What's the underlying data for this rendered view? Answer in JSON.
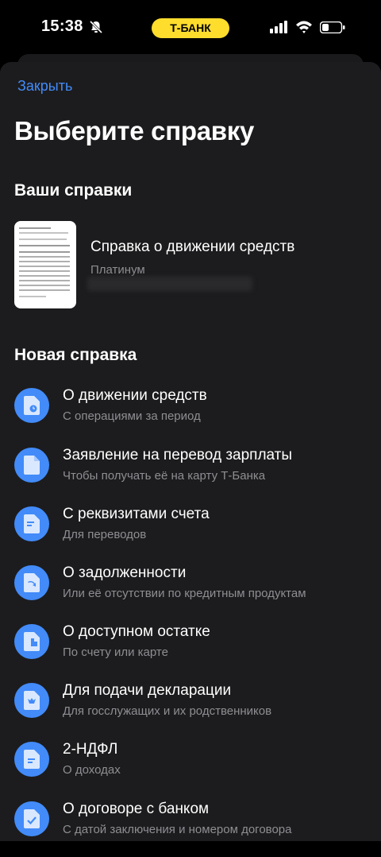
{
  "status_bar": {
    "time": "15:38",
    "bank_pill": "Т-БАНК"
  },
  "colors": {
    "accent": "#428bf9",
    "sheet": "#1c1c1e",
    "pill": "#ffdd2d"
  },
  "header": {
    "close_label": "Закрыть",
    "title": "Выберите справку"
  },
  "your_certificates": {
    "heading": "Ваши справки",
    "items": [
      {
        "title": "Справка о движении средств",
        "subtitle": "Платинум"
      }
    ]
  },
  "new_certificate": {
    "heading": "Новая справка",
    "items": [
      {
        "title": "О движении средств",
        "subtitle": "С операциями за период",
        "icon": "document-clock-icon"
      },
      {
        "title": "Заявление на перевод зарплаты",
        "subtitle": "Чтобы получать её на карту Т-Банка",
        "icon": "document-icon"
      },
      {
        "title": "С реквизитами счета",
        "subtitle": "Для переводов",
        "icon": "document-lines-icon"
      },
      {
        "title": "О задолженности",
        "subtitle": "Или её отсутствии по кредитным продуктам",
        "icon": "document-arrow-icon"
      },
      {
        "title": "О доступном остатке",
        "subtitle": "По счету или карте",
        "icon": "document-balance-icon"
      },
      {
        "title": "Для подачи декларации",
        "subtitle": "Для госслужащих и их родственников",
        "icon": "document-emblem-icon"
      },
      {
        "title": "2-НДФЛ",
        "subtitle": "О доходах",
        "icon": "document-text-icon"
      },
      {
        "title": "О договоре с банком",
        "subtitle": "С датой заключения и номером договора",
        "icon": "document-check-icon"
      }
    ]
  }
}
